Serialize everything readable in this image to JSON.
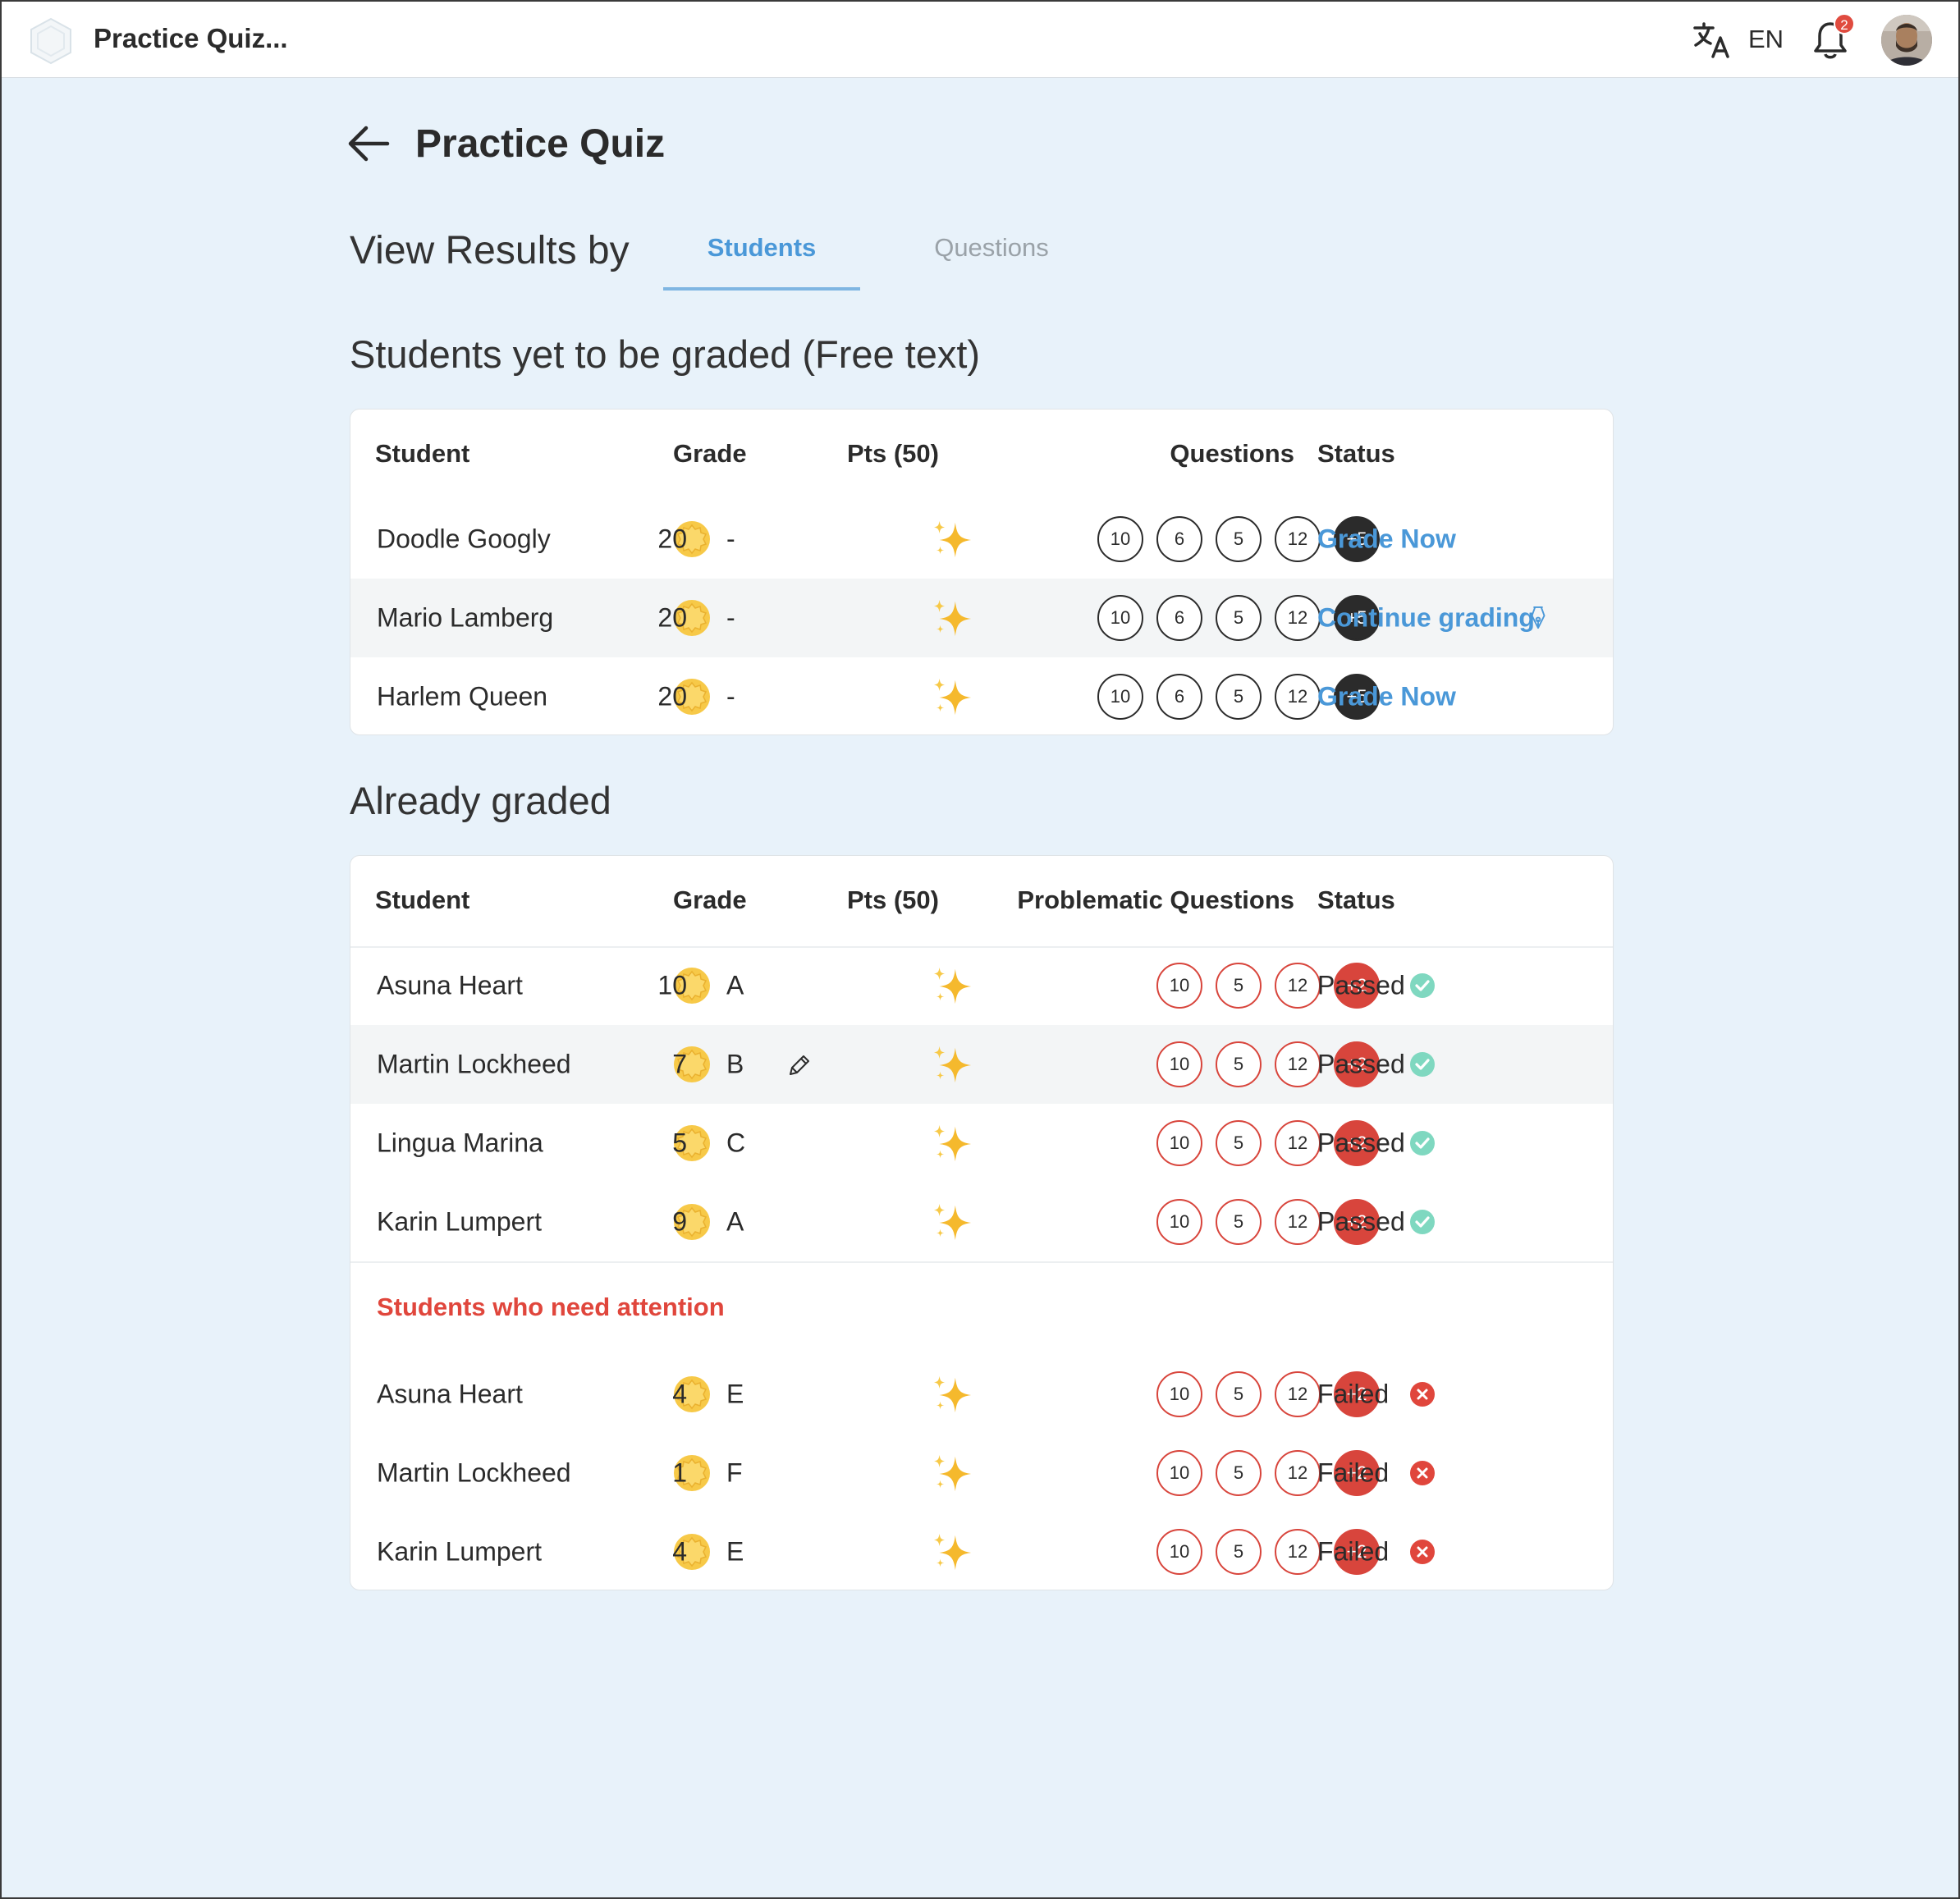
{
  "header": {
    "app_title": "Practice Quiz...",
    "language": "EN",
    "notification_count": "2"
  },
  "page": {
    "title": "Practice Quiz",
    "view_results_by": "View Results by",
    "tabs": [
      {
        "label": "Students",
        "active": true
      },
      {
        "label": "Questions",
        "active": false
      }
    ]
  },
  "pending": {
    "section_title": "Students yet to be graded (Free text)",
    "columns": {
      "student": "Student",
      "grade": "Grade",
      "pts": "Pts (50)",
      "questions": "Questions",
      "status": "Status"
    },
    "rows": [
      {
        "name": "Doodle Googly",
        "grade": "-",
        "pts": "20",
        "questions": [
          "10",
          "6",
          "5",
          "12"
        ],
        "more": "+5",
        "action": "Grade Now"
      },
      {
        "name": "Mario Lamberg",
        "grade": "-",
        "pts": "20",
        "questions": [
          "10",
          "6",
          "5",
          "12"
        ],
        "more": "+5",
        "action": "Continue grading"
      },
      {
        "name": "Harlem Queen",
        "grade": "-",
        "pts": "20",
        "questions": [
          "10",
          "6",
          "5",
          "12"
        ],
        "more": "+5",
        "action": "Grade Now"
      }
    ]
  },
  "graded": {
    "section_title": "Already graded",
    "columns": {
      "student": "Student",
      "grade": "Grade",
      "pts": "Pts (50)",
      "questions": "Problematic Questions",
      "status": "Status"
    },
    "rows": [
      {
        "name": "Asuna Heart",
        "grade": "A",
        "pts": "10",
        "questions": [
          "10",
          "5",
          "12"
        ],
        "more": "+2",
        "status": "Passed"
      },
      {
        "name": "Martin Lockheed",
        "grade": "B",
        "pts": "7",
        "questions": [
          "10",
          "5",
          "12"
        ],
        "more": "+2",
        "status": "Passed"
      },
      {
        "name": "Lingua Marina",
        "grade": "C",
        "pts": "5",
        "questions": [
          "10",
          "5",
          "12"
        ],
        "more": "+2",
        "status": "Passed"
      },
      {
        "name": "Karin Lumpert",
        "grade": "A",
        "pts": "9",
        "questions": [
          "10",
          "5",
          "12"
        ],
        "more": "+2",
        "status": "Passed"
      }
    ],
    "attention_title": "Students who need attention",
    "attention_rows": [
      {
        "name": "Asuna Heart",
        "grade": "E",
        "pts": "4",
        "questions": [
          "10",
          "5",
          "12"
        ],
        "more": "+2",
        "status": "Failed"
      },
      {
        "name": "Martin Lockheed",
        "grade": "F",
        "pts": "1",
        "questions": [
          "10",
          "5",
          "12"
        ],
        "more": "+2",
        "status": "Failed"
      },
      {
        "name": "Karin Lumpert",
        "grade": "E",
        "pts": "4",
        "questions": [
          "10",
          "5",
          "12"
        ],
        "more": "+2",
        "status": "Failed"
      }
    ]
  },
  "colors": {
    "accent": "#4a98d8",
    "danger": "#d8453c",
    "success": "#7fd8c0",
    "background": "#e8f2fa"
  },
  "icons": [
    "app-logo-icon",
    "translate-icon",
    "bell-icon",
    "back-arrow-icon",
    "medal-icon",
    "sparkle-icon",
    "pen-nib-icon",
    "pencil-icon",
    "check-icon",
    "cross-icon"
  ]
}
